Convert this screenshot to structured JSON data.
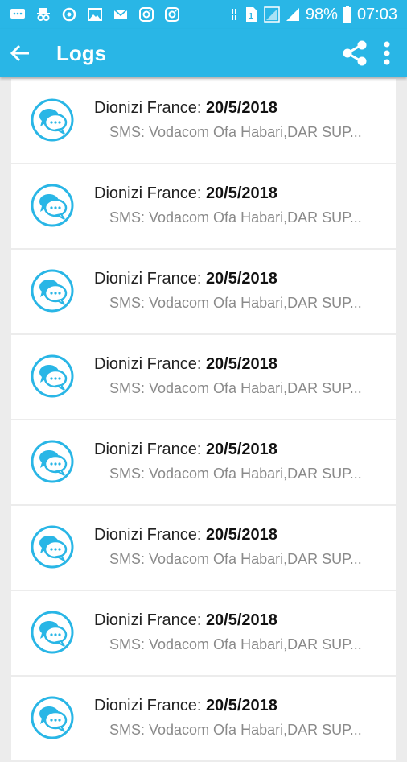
{
  "status_bar": {
    "battery": "98%",
    "time": "07:03",
    "left_icons": [
      "messages-icon",
      "incognito-icon",
      "sync-icon",
      "gallery-icon",
      "email-icon",
      "instagram-icon",
      "instagram-icon"
    ],
    "right_icons": [
      "network-type-icon",
      "sim1-icon",
      "signal-icon",
      "signal-icon",
      "battery-icon"
    ]
  },
  "app_bar": {
    "title": "Logs",
    "background": "#29b6e6",
    "actions": [
      "share-icon",
      "more-vert-icon"
    ]
  },
  "logs": [
    {
      "name": "Dionizi France: ",
      "date": "20/5/2018",
      "preview": "SMS: Vodacom Ofa Habari,DAR SUP..."
    },
    {
      "name": "Dionizi France: ",
      "date": "20/5/2018",
      "preview": "SMS: Vodacom Ofa Habari,DAR SUP..."
    },
    {
      "name": "Dionizi France: ",
      "date": "20/5/2018",
      "preview": "SMS: Vodacom Ofa Habari,DAR SUP..."
    },
    {
      "name": "Dionizi France: ",
      "date": "20/5/2018",
      "preview": "SMS: Vodacom Ofa Habari,DAR SUP..."
    },
    {
      "name": "Dionizi France: ",
      "date": "20/5/2018",
      "preview": "SMS: Vodacom Ofa Habari,DAR SUP..."
    },
    {
      "name": "Dionizi France: ",
      "date": "20/5/2018",
      "preview": "SMS: Vodacom Ofa Habari,DAR SUP..."
    },
    {
      "name": "Dionizi France: ",
      "date": "20/5/2018",
      "preview": "SMS: Vodacom Ofa Habari,DAR SUP..."
    },
    {
      "name": "Dionizi France: ",
      "date": "20/5/2018",
      "preview": "SMS: Vodacom Ofa Habari,DAR SUP..."
    }
  ]
}
